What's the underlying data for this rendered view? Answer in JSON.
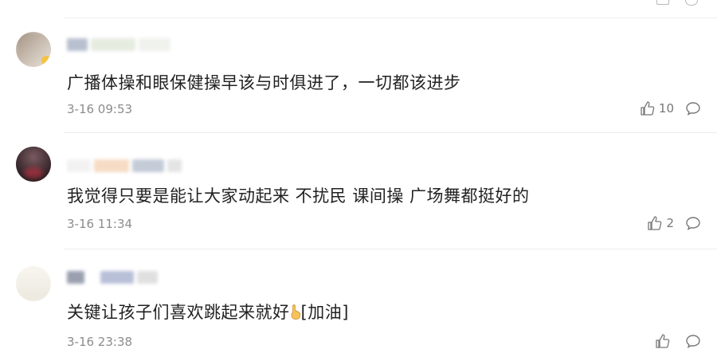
{
  "comments": [
    {
      "text": "广播体操和眼保健操早该与时俱进了，一切都该进步",
      "time": "3-16 09:53",
      "likes": "10"
    },
    {
      "text": "我觉得只要是能让大家动起来 不扰民 课间操 广场舞都挺好的",
      "time": "3-16 11:34",
      "likes": "2"
    },
    {
      "text": "关键让孩子们喜欢跳起来就好",
      "sticker": "[加油]",
      "time": "3-16 23:38",
      "likes": ""
    }
  ],
  "icons": {
    "like": "thumbs-up-icon",
    "reply": "comment-bubble-icon",
    "emoji": "pointing-hand-emoji"
  },
  "colors": {
    "text": "#222222",
    "meta": "#8c8c8c",
    "divider": "#eeeeee"
  }
}
